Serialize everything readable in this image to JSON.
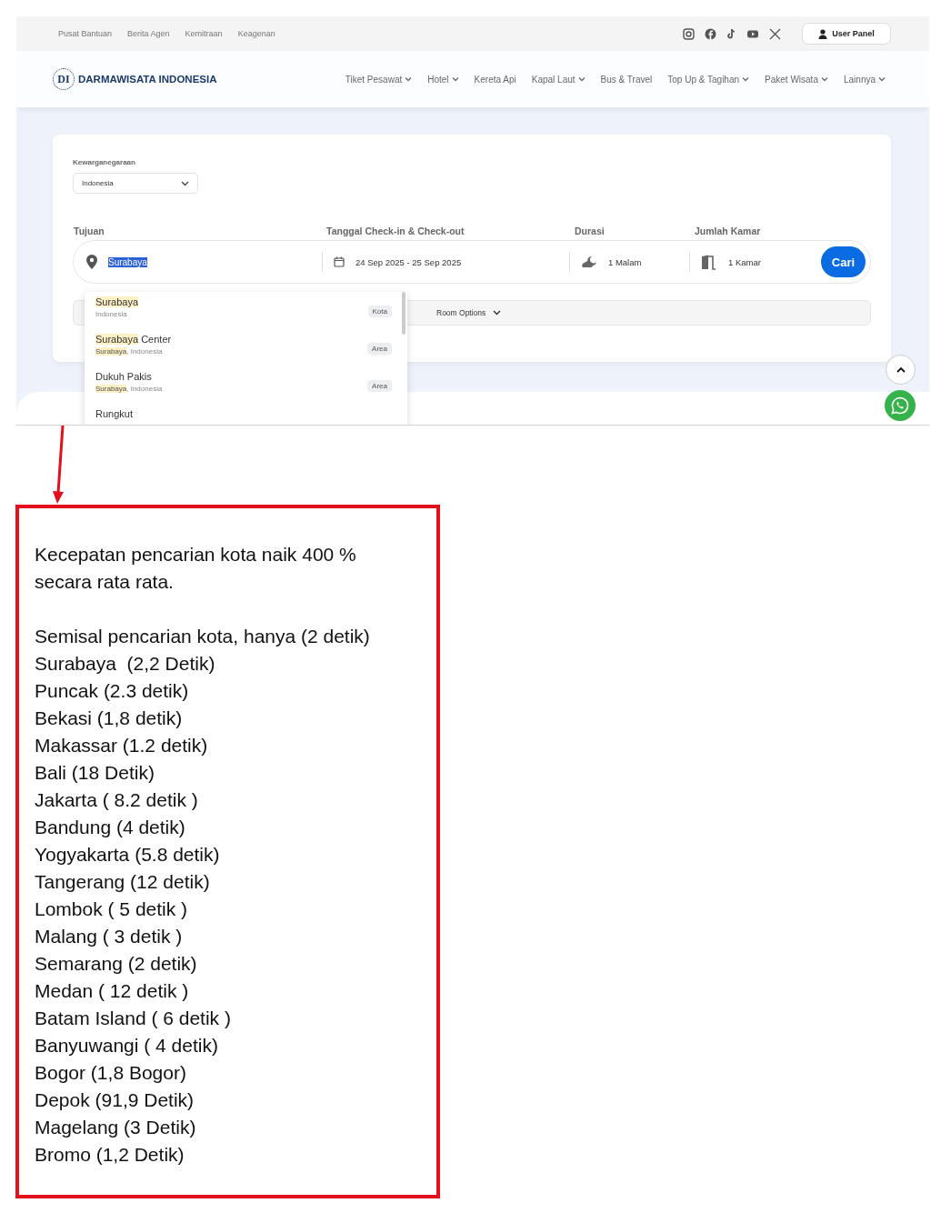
{
  "top_links": [
    "Pusat Bantuan",
    "Berita Agen",
    "Kemitraan",
    "Keagenan"
  ],
  "user_panel": "User Panel",
  "logo": {
    "mark": "DI",
    "name": "DARMAWISATA INDONESIA"
  },
  "nav": [
    {
      "label": "Tiket Pesawat",
      "has_menu": true
    },
    {
      "label": "Hotel",
      "has_menu": true
    },
    {
      "label": "Kereta Api",
      "has_menu": false
    },
    {
      "label": "Kapal Laut",
      "has_menu": true
    },
    {
      "label": "Bus & Travel",
      "has_menu": false
    },
    {
      "label": "Top Up & Tagihan",
      "has_menu": true
    },
    {
      "label": "Paket Wisata",
      "has_menu": true
    },
    {
      "label": "Lainnya",
      "has_menu": true
    }
  ],
  "nationality": {
    "label": "Kewarganegaraan",
    "value": "Indonesia"
  },
  "search": {
    "labels": [
      "Tujuan",
      "Tanggal Check-in & Check-out",
      "Durasi",
      "Jumlah Kamar"
    ],
    "destination": "Surabaya",
    "dates": "24 Sep 2025 - 25 Sep 2025",
    "duration": "1 Malam",
    "rooms": "1 Kamar",
    "button": "Cari",
    "room_options": "Room Options"
  },
  "suggestions": [
    {
      "name_match": "Surabaya",
      "sub_rest": "Indonesia",
      "type": "Kota"
    },
    {
      "name_match": "Surabaya",
      "name_rest": " Center",
      "sub_match": "Surabaya",
      "sub_rest": ", Indonesia",
      "type": "Area"
    },
    {
      "name_rest": "Dukuh Pakis",
      "sub_match": "Surabaya",
      "sub_rest": ", Indonesia",
      "type": "Area"
    },
    {
      "name_rest": "Rungkut"
    }
  ],
  "note": {
    "paragraph": "Kecepatan pencarian kota naik 400 % secara rata rata.",
    "lines": [
      "Semisal pencarian kota, hanya (2 detik)",
      "Surabaya  (2,2 Detik)",
      "Puncak (2.3 detik)",
      "Bekasi (1,8 detik)",
      "Makassar (1.2 detik)",
      "Bali (18 Detik)",
      "Jakarta ( 8.2 detik )",
      "Bandung (4 detik)",
      "Yogyakarta (5.8 detik)",
      "Tangerang (12 detik)",
      "Lombok ( 5 detik )",
      "Malang ( 3 detik )",
      "Semarang (2 detik)",
      "Medan ( 12 detik )",
      "Batam Island ( 6 detik )",
      "Banyuwangi ( 4 detik)",
      "Bogor (1,8 Bogor)",
      "Depok (91,9 Detik)",
      "Magelang (3 Detik)",
      "Bromo (1,2 Detik)"
    ]
  }
}
